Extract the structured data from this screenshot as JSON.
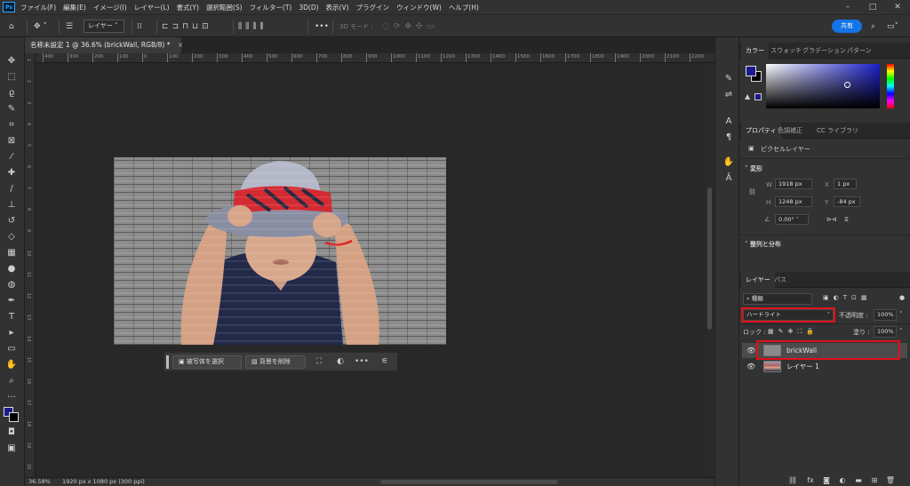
{
  "app": {
    "logo": "Ps"
  },
  "menu": [
    "ファイル(F)",
    "編集(E)",
    "イメージ(I)",
    "レイヤー(L)",
    "書式(Y)",
    "選択範囲(S)",
    "フィルター(T)",
    "3D(D)",
    "表示(V)",
    "プラグイン",
    "ウィンドウ(W)",
    "ヘルプ(H)"
  ],
  "options": {
    "layer_select": "レイヤー",
    "mode3d": "3D モード :",
    "share": "共有",
    "more": "•••"
  },
  "document": {
    "tab": "名称未設定 1 @ 36.6% (brickWall, RGB/8) *",
    "close": "×"
  },
  "rulers": {
    "h": [
      "400",
      "300",
      "200",
      "100",
      "0",
      "100",
      "200",
      "300",
      "400",
      "500",
      "600",
      "700",
      "800",
      "900",
      "1000",
      "1100",
      "1200",
      "1300",
      "1400",
      "1500",
      "1600",
      "1700",
      "1800",
      "1900",
      "2000",
      "2100",
      "2200",
      "2300"
    ],
    "v": [
      "1",
      "2",
      "3",
      "4",
      "5",
      "6",
      "7",
      "8",
      "9",
      "10",
      "11",
      "12",
      "13",
      "14",
      "15",
      "16",
      "17",
      "18",
      "19",
      "20"
    ]
  },
  "status": {
    "zoom": "36.58%",
    "info": "1920 px x 1080 px (300 ppi)"
  },
  "contextbar": {
    "select_subject": "被写体を選択",
    "remove_bg": "背景を削除",
    "more": "•••"
  },
  "color_panel": {
    "tabs": [
      "カラー",
      "スウォッチ",
      "グラデーション",
      "パターン"
    ],
    "fg": "#1b1a8c",
    "bg": "#000000"
  },
  "props_panel": {
    "tabs": [
      "プロパティ",
      "色調補正",
      "CC ライブラリ"
    ],
    "type": "ピクセルレイヤー",
    "transform": "変形",
    "w_label": "W",
    "w": "1918 px",
    "x_label": "X",
    "x": "1 px",
    "h_label": "H",
    "h": "1248 px",
    "y_label": "Y",
    "y": "-84 px",
    "angle": "0.00°",
    "align": "整列と分布"
  },
  "layers_panel": {
    "tabs": [
      "レイヤー",
      "パス"
    ],
    "filter": "種類",
    "blend": "ハードライト",
    "opacity_label": "不透明度 :",
    "opacity": "100%",
    "lock_label": "ロック :",
    "fill_label": "塗り :",
    "fill": "100%",
    "layers": [
      {
        "name": "brickWall"
      },
      {
        "name": "レイヤー 1"
      }
    ]
  },
  "colors": {
    "accent": "#1473e6",
    "highlight": "#e0101b"
  }
}
